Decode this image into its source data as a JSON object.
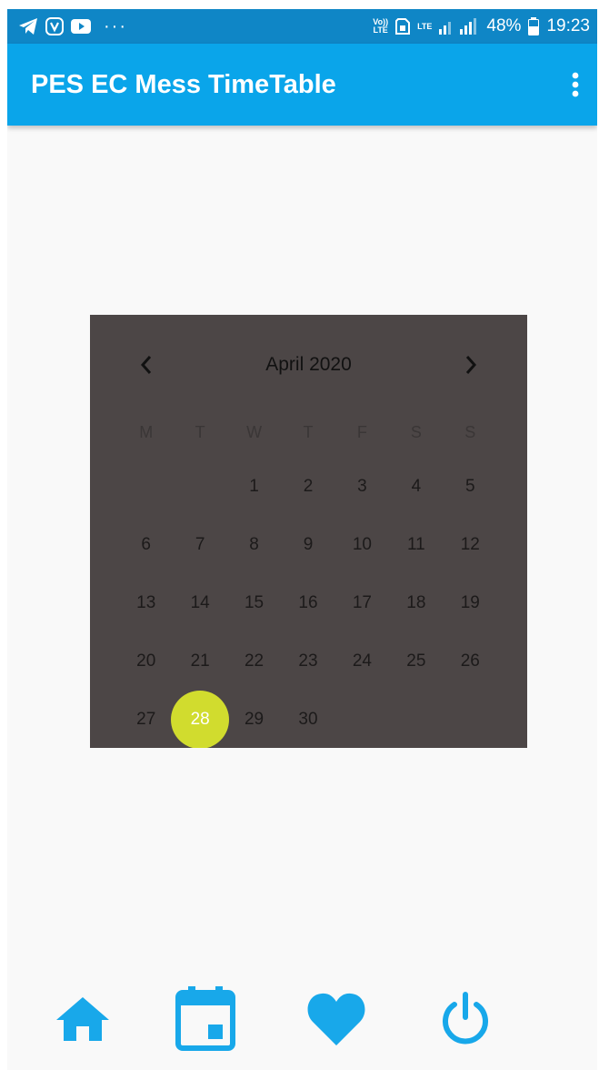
{
  "status_bar": {
    "volte_label": "Vo))\nLTE",
    "lte_label": "LTE",
    "battery_percent": "48%",
    "time": "19:23",
    "more_notifications": "···",
    "icons": [
      "telegram-icon",
      "saavn-icon",
      "youtube-icon",
      "sim-icon",
      "signal-icon",
      "battery-icon"
    ]
  },
  "app_bar": {
    "title": "PES EC Mess TimeTable",
    "overflow_icon": "more-vert-icon"
  },
  "calendar": {
    "month_title": "April 2020",
    "weekdays": [
      "M",
      "T",
      "W",
      "T",
      "F",
      "S",
      "S"
    ],
    "leading_blanks": 2,
    "days": [
      1,
      2,
      3,
      4,
      5,
      6,
      7,
      8,
      9,
      10,
      11,
      12,
      13,
      14,
      15,
      16,
      17,
      18,
      19,
      20,
      21,
      22,
      23,
      24,
      25,
      26,
      27,
      28,
      29,
      30
    ],
    "selected_day": 28,
    "colors": {
      "background": "#4c4646",
      "selected": "#d1dc2e"
    }
  },
  "bottom_nav": {
    "items": [
      "home-icon",
      "calendar-icon",
      "favorite-icon",
      "power-icon"
    ],
    "accent_color": "#18a8ea"
  },
  "colors": {
    "status_bar": "#0f86c6",
    "app_bar": "#0aa5ea",
    "background": "#f9f9f9"
  }
}
